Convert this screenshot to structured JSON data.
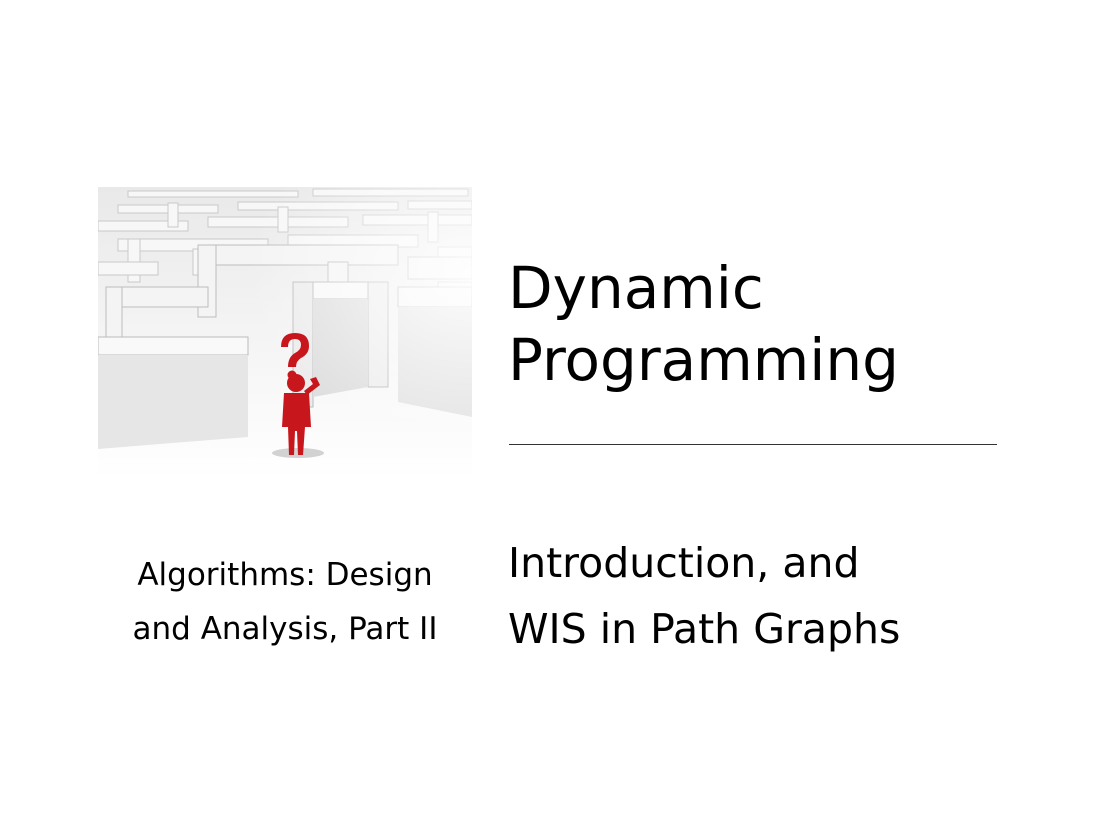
{
  "slide": {
    "title_lines": [
      "Dynamic",
      "Programming"
    ],
    "course_lines": [
      "Algorithms: Design",
      "and Analysis, Part II"
    ],
    "subtitle_lines": [
      "Introduction, and",
      "WIS in Path Graphs"
    ],
    "image": {
      "subject": "maze-with-confused-figure-illustration",
      "figure_color": "#c8161d",
      "wall_color": "#f2f2f2"
    }
  }
}
